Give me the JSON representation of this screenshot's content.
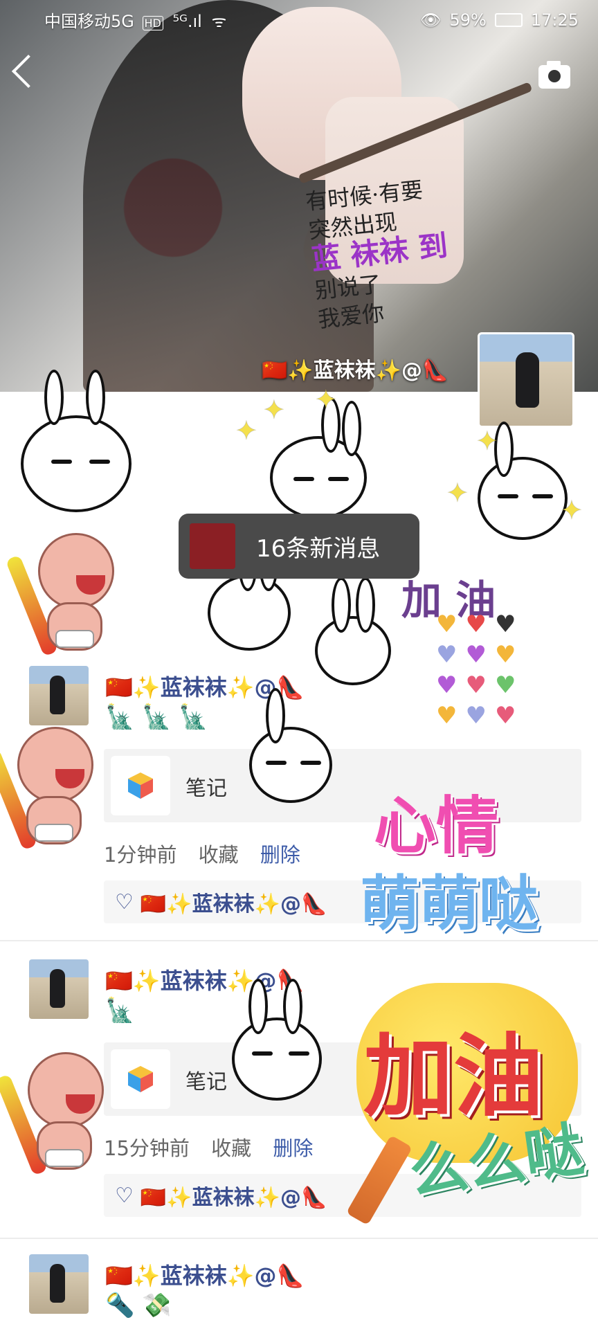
{
  "status_bar": {
    "carrier": "中国移动5G",
    "hd": "HD",
    "signal": "⁵ᴳ.ıl",
    "wifi": "ᯤ",
    "eye": "👁",
    "battery": "59%",
    "time": "17:25"
  },
  "header": {
    "cover_poem_lines": [
      "有时候·有要",
      "突然出现",
      "蓝袜袜到",
      "别说了",
      "我爱你"
    ],
    "cover_highlight": "蓝 袜袜 到",
    "profile_name": "🇨🇳✨蓝袜袜✨@👠"
  },
  "toast": {
    "text": "16条新消息"
  },
  "posts": [
    {
      "name": "🇨🇳✨蓝袜袜✨@👠",
      "emojis": "🗽 🗽 🗽",
      "card_label": "笔记",
      "time": "1分钟前",
      "collect": "收藏",
      "delete": "删除",
      "likes": "🇨🇳✨蓝袜袜✨@👠"
    },
    {
      "name": "🇨🇳✨蓝袜袜✨@👠",
      "emojis": "🗽",
      "card_label": "笔记",
      "time": "15分钟前",
      "collect": "收藏",
      "delete": "删除",
      "likes": "🇨🇳✨蓝袜袜✨@👠"
    },
    {
      "name": "🇨🇳✨蓝袜袜✨@👠",
      "emojis": "🔦 💸"
    }
  ],
  "stickers": {
    "jiayou_small": "加 油",
    "xinqing": "心情",
    "mengmengda": "萌萌哒",
    "jiayou_big": "加油",
    "meme": "么么哒"
  },
  "icons": {
    "back": "back-arrow-icon",
    "camera": "camera-icon",
    "heart": "heart-outline-icon"
  },
  "colors": {
    "name_blue": "#3c4f8f",
    "delete_blue": "#3c5ba8",
    "toast_bg": "#4a4a4a"
  }
}
